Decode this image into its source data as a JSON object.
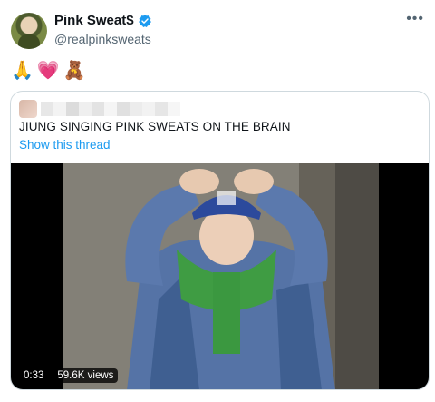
{
  "author": {
    "display_name": "Pink Sweat$",
    "handle": "@realpinksweats"
  },
  "tweet": {
    "emojis": [
      "🙏",
      "💗",
      "🧸"
    ]
  },
  "quoted": {
    "text": "JIUNG SINGING PINK SWEATS ON THE BRAIN",
    "thread_link": "Show this thread"
  },
  "video": {
    "duration": "0:33",
    "views": "59.6K views"
  },
  "colors": {
    "accent": "#1d9bf0",
    "verified": "#1d9bf0",
    "secondary_text": "#536471",
    "border": "#cfd9de"
  }
}
